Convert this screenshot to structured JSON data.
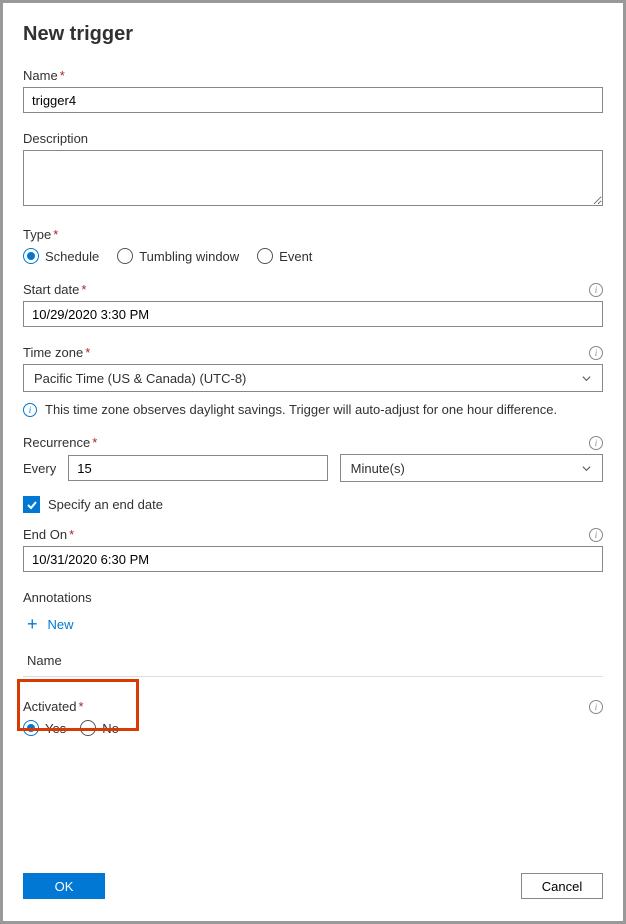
{
  "title": "New trigger",
  "name": {
    "label": "Name",
    "value": "trigger4"
  },
  "description": {
    "label": "Description",
    "value": ""
  },
  "type": {
    "label": "Type",
    "options": [
      "Schedule",
      "Tumbling window",
      "Event"
    ],
    "selected": "Schedule"
  },
  "startDate": {
    "label": "Start date",
    "value": "10/29/2020 3:30 PM"
  },
  "timeZone": {
    "label": "Time zone",
    "value": "Pacific Time (US & Canada) (UTC-8)",
    "note": "This time zone observes daylight savings. Trigger will auto-adjust for one hour difference."
  },
  "recurrence": {
    "label": "Recurrence",
    "everyLabel": "Every",
    "value": "15",
    "unit": "Minute(s)"
  },
  "specifyEnd": {
    "label": "Specify an end date",
    "checked": true
  },
  "endOn": {
    "label": "End On",
    "value": "10/31/2020 6:30 PM"
  },
  "annotations": {
    "label": "Annotations",
    "newLabel": "New",
    "columnHeader": "Name"
  },
  "activated": {
    "label": "Activated",
    "options": [
      "Yes",
      "No"
    ],
    "selected": "Yes"
  },
  "buttons": {
    "ok": "OK",
    "cancel": "Cancel"
  }
}
